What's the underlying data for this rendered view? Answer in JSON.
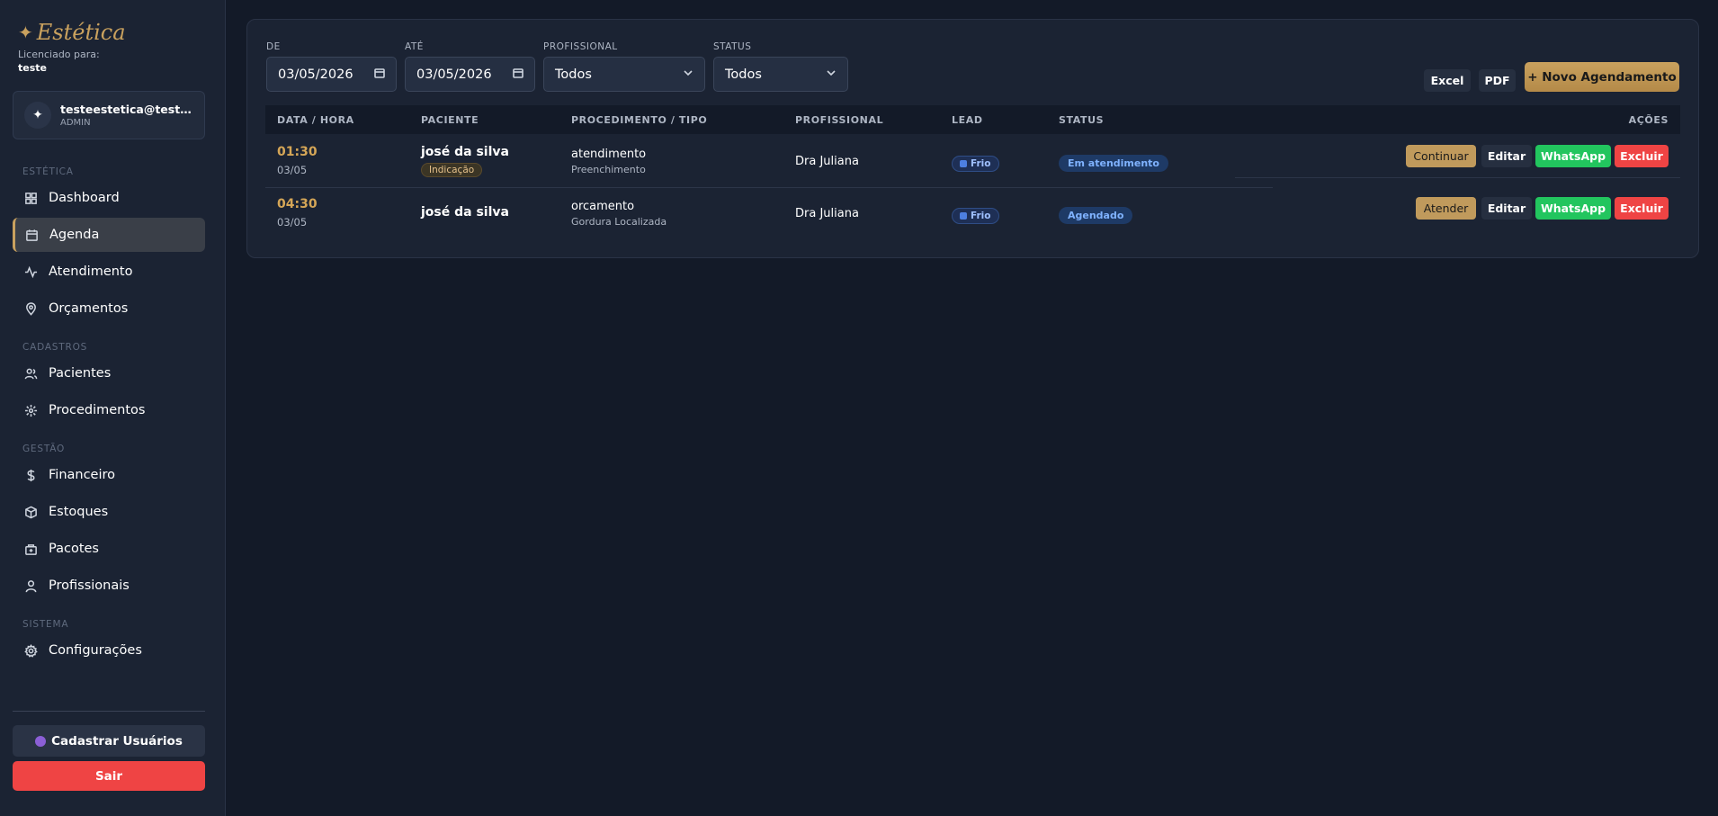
{
  "brand": {
    "title": "Estética",
    "licensed_label": "Licenciado para:",
    "licensed_user": "teste"
  },
  "user": {
    "email": "testeestetica@teste.c…",
    "role": "ADMIN"
  },
  "sidebar": {
    "sections": {
      "estetica": "ESTÉTICA",
      "cadastros": "CADASTROS",
      "gestao": "GESTÃO",
      "sistema": "SISTEMA"
    },
    "items": [
      {
        "label": "Dashboard",
        "icon": "grid-icon"
      },
      {
        "label": "Agenda",
        "icon": "calendar-icon",
        "active": true
      },
      {
        "label": "Atendimento",
        "icon": "activity-icon"
      },
      {
        "label": "Orçamentos",
        "icon": "map-pin-icon"
      },
      {
        "label": "Pacientes",
        "icon": "users-icon"
      },
      {
        "label": "Procedimentos",
        "icon": "sparkle-icon"
      },
      {
        "label": "Financeiro",
        "icon": "dollar-icon"
      },
      {
        "label": "Estoques",
        "icon": "box-icon"
      },
      {
        "label": "Pacotes",
        "icon": "package-icon"
      },
      {
        "label": "Profissionais",
        "icon": "user-icon"
      },
      {
        "label": "Configurações",
        "icon": "gear-icon"
      }
    ],
    "register_label": "Cadastrar Usuários",
    "logout_label": "Sair"
  },
  "filters": {
    "de_label": "DE",
    "de_value": "03/05/2026",
    "ate_label": "ATÉ",
    "ate_value": "03/05/2026",
    "profissional_label": "PROFISSIONAL",
    "profissional_value": "Todos",
    "status_label": "STATUS",
    "status_value": "Todos"
  },
  "toolbar": {
    "excel_label": "Excel",
    "pdf_label": "PDF",
    "new_label": "+ Novo Agendamento"
  },
  "table": {
    "headers": {
      "datetime": "DATA / HORA",
      "patient": "PACIENTE",
      "procedure": "PROCEDIMENTO / TIPO",
      "professional": "PROFISSIONAL",
      "lead": "LEAD",
      "status": "STATUS",
      "actions": "AÇÕES"
    },
    "rows": [
      {
        "time": "01:30",
        "date": "03/05",
        "patient": "josé da silva",
        "tag": "Indicação",
        "procedure": "atendimento",
        "procedure_type": "Preenchimento",
        "professional": "Dra Juliana",
        "lead": "Frio",
        "status": "Em atendimento",
        "primary_action": "Continuar",
        "edit": "Editar",
        "whatsapp": "WhatsApp",
        "delete": "Excluir"
      },
      {
        "time": "04:30",
        "date": "03/05",
        "patient": "josé da silva",
        "procedure": "orcamento",
        "procedure_type": "Gordura Localizada",
        "professional": "Dra Juliana",
        "lead": "Frio",
        "status": "Agendado",
        "primary_action": "Atender",
        "edit": "Editar",
        "whatsapp": "WhatsApp",
        "delete": "Excluir"
      }
    ]
  },
  "colors": {
    "accent_gold": "#c9a15e",
    "whatsapp_green": "#22c55e",
    "danger_red": "#ef4444",
    "status_blue": "#7fb2ff"
  }
}
